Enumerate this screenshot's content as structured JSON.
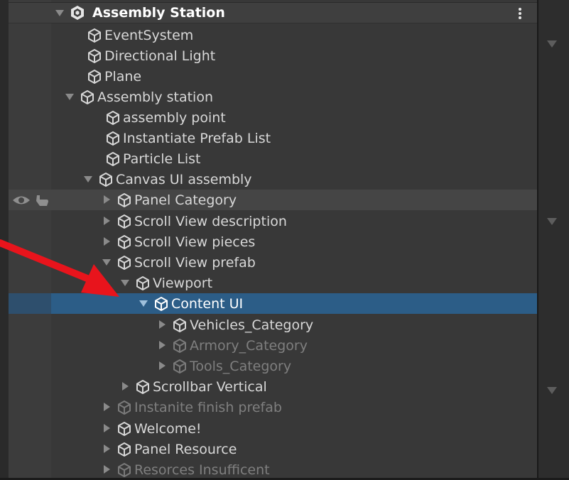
{
  "colors": {
    "selection": "#2c5d87",
    "arrow": "#e8141c",
    "text": "#d8d8d8",
    "text_disabled": "#7f7f7f"
  },
  "scene": {
    "title": "Assembly Station",
    "icon": "unity-scene-icon",
    "menu_icon": "kebab-menu-icon"
  },
  "items": [
    {
      "label": "EventSystem",
      "state": "leaf"
    },
    {
      "label": "Directional Light",
      "state": "leaf"
    },
    {
      "label": "Plane",
      "state": "leaf"
    },
    {
      "label": "Assembly station",
      "state": "expanded"
    },
    {
      "label": "assembly point",
      "state": "leaf"
    },
    {
      "label": "Instantiate Prefab List",
      "state": "leaf"
    },
    {
      "label": "Particle List",
      "state": "leaf"
    },
    {
      "label": "Canvas UI assembly",
      "state": "expanded"
    },
    {
      "label": "Panel Category",
      "state": "collapsed",
      "hovered": true
    },
    {
      "label": "Scroll View description",
      "state": "collapsed"
    },
    {
      "label": "Scroll View pieces",
      "state": "collapsed"
    },
    {
      "label": "Scroll View prefab",
      "state": "expanded"
    },
    {
      "label": "Viewport",
      "state": "expanded"
    },
    {
      "label": "Content UI",
      "state": "expanded",
      "selected": true
    },
    {
      "label": "Vehicles_Category",
      "state": "collapsed"
    },
    {
      "label": "Armory_Category",
      "state": "collapsed",
      "inactive": true
    },
    {
      "label": "Tools_Category",
      "state": "collapsed",
      "inactive": true
    },
    {
      "label": "Scrollbar Vertical",
      "state": "collapsed"
    },
    {
      "label": "Instanite finish prefab",
      "state": "collapsed",
      "inactive": true
    },
    {
      "label": "Welcome!",
      "state": "collapsed"
    },
    {
      "label": "Panel Resource",
      "state": "collapsed"
    },
    {
      "label": "Resorces Insuffiсent",
      "state": "collapsed",
      "inactive": true
    }
  ],
  "hover_icons": [
    "eye-icon",
    "hand-pick-icon"
  ],
  "annotation": {
    "type": "arrow",
    "color": "#e8141c",
    "target": "Content UI"
  }
}
